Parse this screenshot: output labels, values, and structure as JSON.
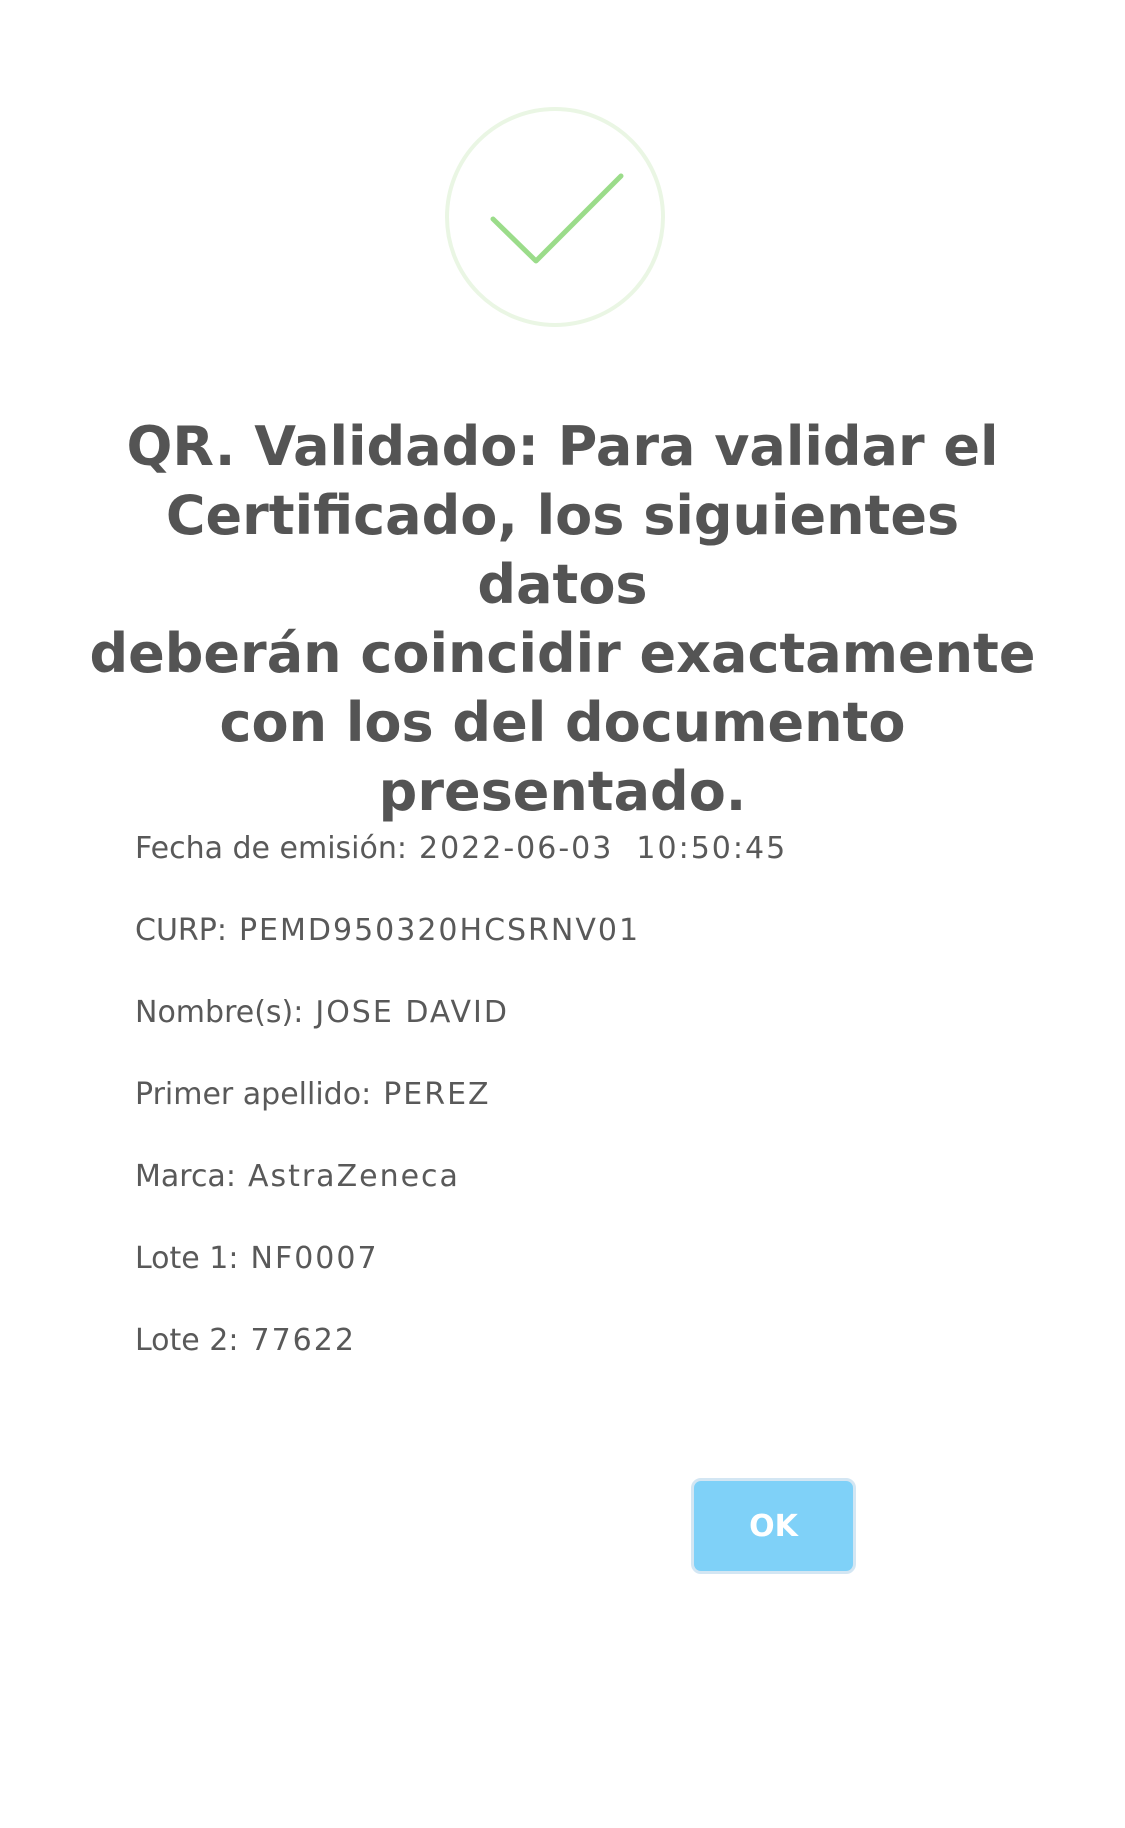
{
  "dialog": {
    "icon": "success-checkmark-icon",
    "title_lines": [
      "QR. Validado: Para validar el",
      "Certificado, los siguientes datos",
      "deberán coincidir exactamente",
      "con los del documento",
      "presentado."
    ],
    "details": [
      {
        "label": "Fecha de emisión:",
        "value": "2022-06-03  10:50:45"
      },
      {
        "label": "CURP:",
        "value": "PEMD950320HCSRNV01"
      },
      {
        "label": "Nombre(s):",
        "value": "JOSE DAVID"
      },
      {
        "label": "Primer apellido:",
        "value": "PEREZ"
      },
      {
        "label": "Marca:",
        "value": "AstraZeneca"
      },
      {
        "label": "Lote 1:",
        "value": "NF0007"
      },
      {
        "label": "Lote 2:",
        "value": "77622"
      }
    ],
    "ok_label": "OK"
  },
  "colors": {
    "check": "#9bdc8a",
    "circle": "#eaf6e4",
    "title": "#545454",
    "text": "#595959",
    "button": "#7fd1f8"
  }
}
